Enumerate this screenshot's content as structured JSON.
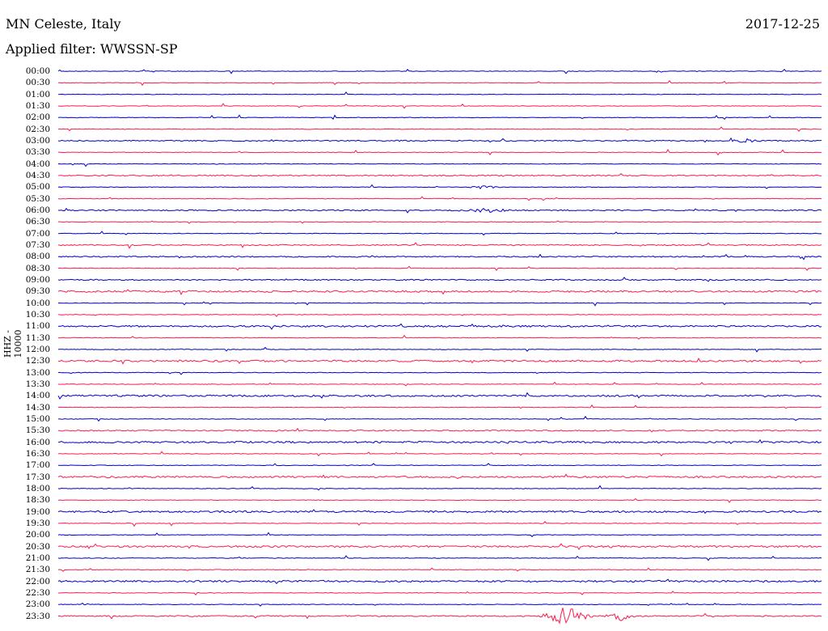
{
  "header": {
    "station": "MN Celeste, Italy",
    "date": "2017-12-25",
    "filter_text": "Applied filter: WWSSN-SP"
  },
  "colors": {
    "trace_a": "#0000cc",
    "trace_b": "#ff1a4d",
    "text": "#000000"
  },
  "chart_data": {
    "type": "line",
    "title": "MN Celeste, Italy",
    "ylabel": "HHZ - 10000",
    "xlabel": "",
    "rows": [
      {
        "label": "00:00",
        "color": "a",
        "level": 1
      },
      {
        "label": "00:30",
        "color": "b",
        "level": 1
      },
      {
        "label": "01:00",
        "color": "a",
        "level": 1
      },
      {
        "label": "01:30",
        "color": "b",
        "level": 1
      },
      {
        "label": "02:00",
        "color": "a",
        "level": 1
      },
      {
        "label": "02:30",
        "color": "b",
        "level": 1
      },
      {
        "label": "03:00",
        "color": "a",
        "level": 2
      },
      {
        "label": "03:30",
        "color": "b",
        "level": 1
      },
      {
        "label": "04:00",
        "color": "a",
        "level": 1
      },
      {
        "label": "04:30",
        "color": "b",
        "level": 2
      },
      {
        "label": "05:00",
        "color": "a",
        "level": 1
      },
      {
        "label": "05:30",
        "color": "b",
        "level": 1
      },
      {
        "label": "06:00",
        "color": "a",
        "level": 2
      },
      {
        "label": "06:30",
        "color": "b",
        "level": 1
      },
      {
        "label": "07:00",
        "color": "a",
        "level": 1
      },
      {
        "label": "07:30",
        "color": "b",
        "level": 2
      },
      {
        "label": "08:00",
        "color": "a",
        "level": 2
      },
      {
        "label": "08:30",
        "color": "b",
        "level": 1
      },
      {
        "label": "09:00",
        "color": "a",
        "level": 2
      },
      {
        "label": "09:30",
        "color": "b",
        "level": 3
      },
      {
        "label": "10:00",
        "color": "a",
        "level": 1
      },
      {
        "label": "10:30",
        "color": "b",
        "level": 1
      },
      {
        "label": "11:00",
        "color": "a",
        "level": 3
      },
      {
        "label": "11:30",
        "color": "b",
        "level": 1
      },
      {
        "label": "12:00",
        "color": "a",
        "level": 1
      },
      {
        "label": "12:30",
        "color": "b",
        "level": 3
      },
      {
        "label": "13:00",
        "color": "a",
        "level": 1
      },
      {
        "label": "13:30",
        "color": "b",
        "level": 1
      },
      {
        "label": "14:00",
        "color": "a",
        "level": 3
      },
      {
        "label": "14:30",
        "color": "b",
        "level": 1
      },
      {
        "label": "15:00",
        "color": "a",
        "level": 1
      },
      {
        "label": "15:30",
        "color": "b",
        "level": 2
      },
      {
        "label": "16:00",
        "color": "a",
        "level": 3
      },
      {
        "label": "16:30",
        "color": "b",
        "level": 1
      },
      {
        "label": "17:00",
        "color": "a",
        "level": 1
      },
      {
        "label": "17:30",
        "color": "b",
        "level": 3
      },
      {
        "label": "18:00",
        "color": "a",
        "level": 1
      },
      {
        "label": "18:30",
        "color": "b",
        "level": 1
      },
      {
        "label": "19:00",
        "color": "a",
        "level": 3
      },
      {
        "label": "19:30",
        "color": "b",
        "level": 1
      },
      {
        "label": "20:00",
        "color": "a",
        "level": 1
      },
      {
        "label": "20:30",
        "color": "b",
        "level": 3
      },
      {
        "label": "21:00",
        "color": "a",
        "level": 1
      },
      {
        "label": "21:30",
        "color": "b",
        "level": 1
      },
      {
        "label": "22:00",
        "color": "a",
        "level": 3
      },
      {
        "label": "22:30",
        "color": "b",
        "level": 1
      },
      {
        "label": "23:00",
        "color": "a",
        "level": 1
      },
      {
        "label": "23:30",
        "color": "b",
        "level": 2
      }
    ],
    "events": [
      {
        "row": "05:00",
        "start": 0.53,
        "end": 0.58,
        "amp": 2
      },
      {
        "row": "06:00",
        "start": 0.52,
        "end": 0.6,
        "amp": 2
      },
      {
        "row": "03:00",
        "start": 0.88,
        "end": 0.92,
        "amp": 2
      },
      {
        "row": "23:30",
        "start": 0.63,
        "end": 0.7,
        "amp": 11
      },
      {
        "row": "23:30",
        "start": 0.715,
        "end": 0.755,
        "amp": 6
      }
    ]
  }
}
